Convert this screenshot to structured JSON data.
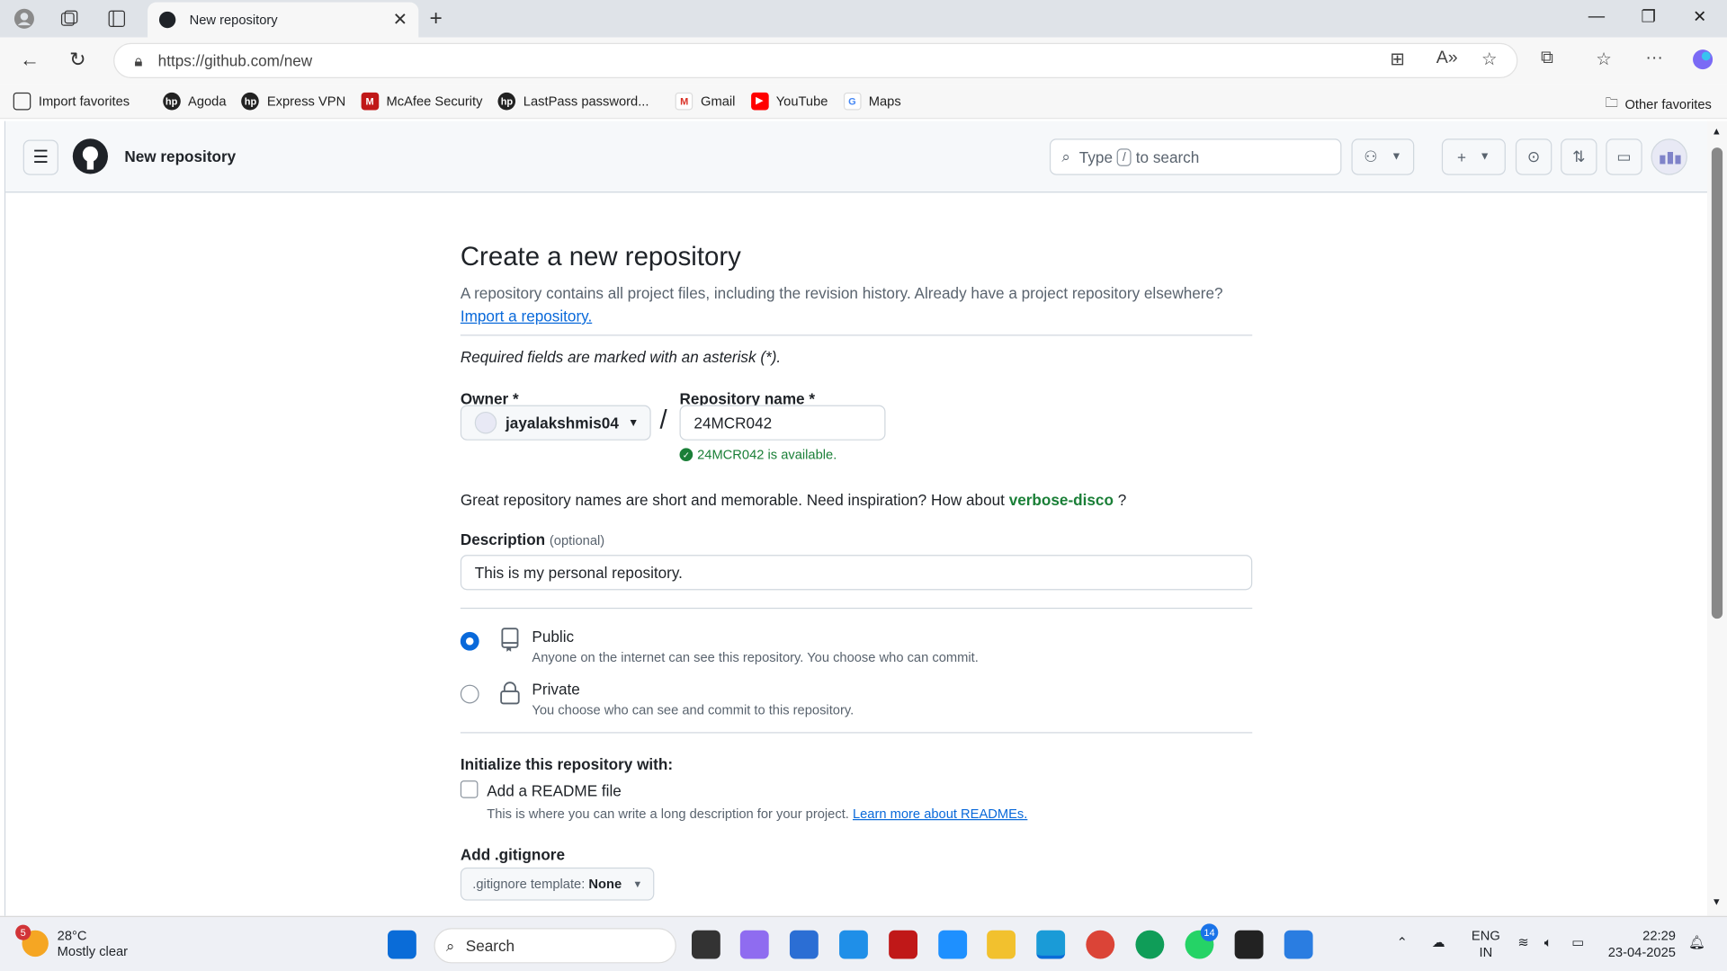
{
  "browser": {
    "tab_title": "New repository",
    "url": "https://github.com/new",
    "favorites": [
      "Import favorites",
      "Agoda",
      "Express VPN",
      "McAfee Security",
      "LastPass password...",
      "Gmail",
      "YouTube",
      "Maps"
    ],
    "other_favorites": "Other favorites"
  },
  "github": {
    "header_title": "New repository",
    "search_prefix": "Type",
    "search_key": "/",
    "search_suffix": "to search"
  },
  "form": {
    "title": "Create a new repository",
    "subtitle": "A repository contains all project files, including the revision history. Already have a project repository elsewhere?",
    "import_link": "Import a repository.",
    "required_note": "Required fields are marked with an asterisk (*).",
    "owner_label": "Owner *",
    "owner_value": "jayalakshmis04",
    "slash": "/",
    "repo_label": "Repository name *",
    "repo_value": "24MCR042",
    "available": "24MCR042 is available.",
    "great_names": "Great repository names are short and memorable. Need inspiration? How about",
    "suggestion": "verbose-disco",
    "question": "?",
    "description_label": "Description",
    "optional": "(optional)",
    "description_value": "This is my personal repository.",
    "public_title": "Public",
    "public_desc": "Anyone on the internet can see this repository. You choose who can commit.",
    "private_title": "Private",
    "private_desc": "You choose who can see and commit to this repository.",
    "init_label": "Initialize this repository with:",
    "readme_label": "Add a README file",
    "readme_desc": "This is where you can write a long description for your project.",
    "readme_link": "Learn more about READMEs.",
    "gitignore_label": "Add .gitignore",
    "gitignore_btn_prefix": ".gitignore template:",
    "gitignore_btn_value": "None"
  },
  "taskbar": {
    "temp": "28°C",
    "weather": "Mostly clear",
    "weather_badge": "5",
    "search": "Search",
    "whatsapp_badge": "14",
    "lang1": "ENG",
    "lang2": "IN",
    "time": "22:29",
    "date": "23-04-2025"
  },
  "colors": {
    "accent": "#0969da",
    "success": "#1a7f37"
  }
}
